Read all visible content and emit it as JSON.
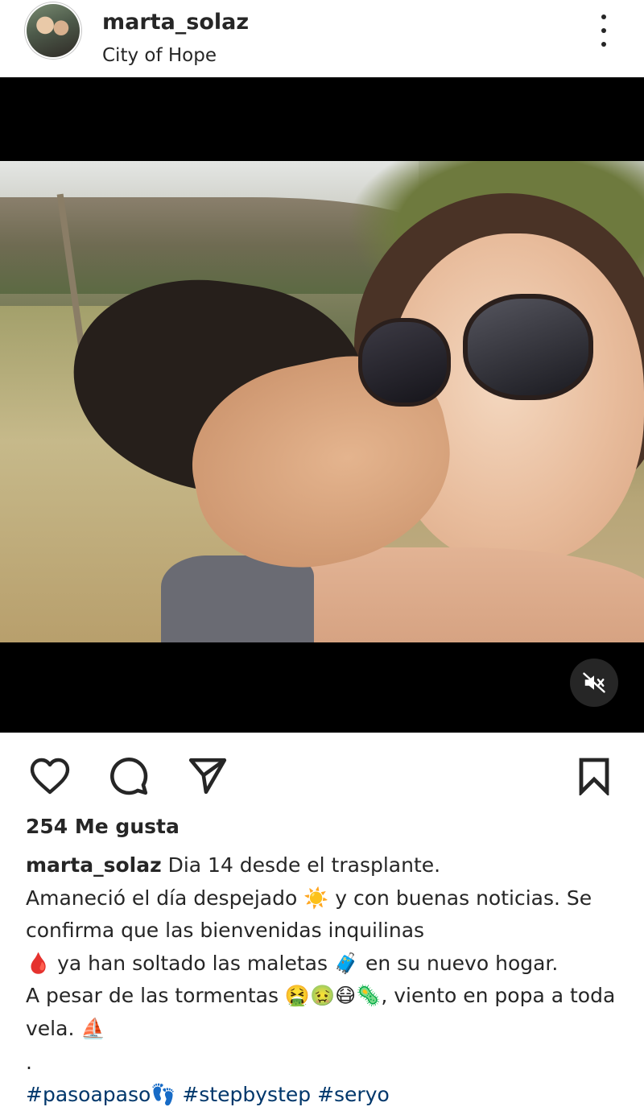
{
  "post": {
    "username": "marta_solaz",
    "location": "City of Hope",
    "likes": "254 Me gusta",
    "caption_text": "Dia 14 desde el trasplante.\nAmaneció  el día despejado ☀️ y con buenas noticias. Se confirma que las bienvenidas inquilinas\n🩸 ya han soltado las maletas 🧳 en su nuevo hogar.\nA pesar de las tormentas 🤮🤢😷🦠, viento en popa a toda vela. ⛵",
    "separator": ".",
    "hashtags": "#pasoapaso👣 #stepbystep #seryo"
  },
  "icons": {
    "more": "more-vertical-icon",
    "mute": "muted-speaker-icon",
    "like": "heart-icon",
    "comment": "comment-bubble-icon",
    "share": "paper-plane-icon",
    "save": "bookmark-icon"
  },
  "colors": {
    "text": "#262626",
    "hashtag": "#00376b",
    "media_background": "#000000"
  }
}
